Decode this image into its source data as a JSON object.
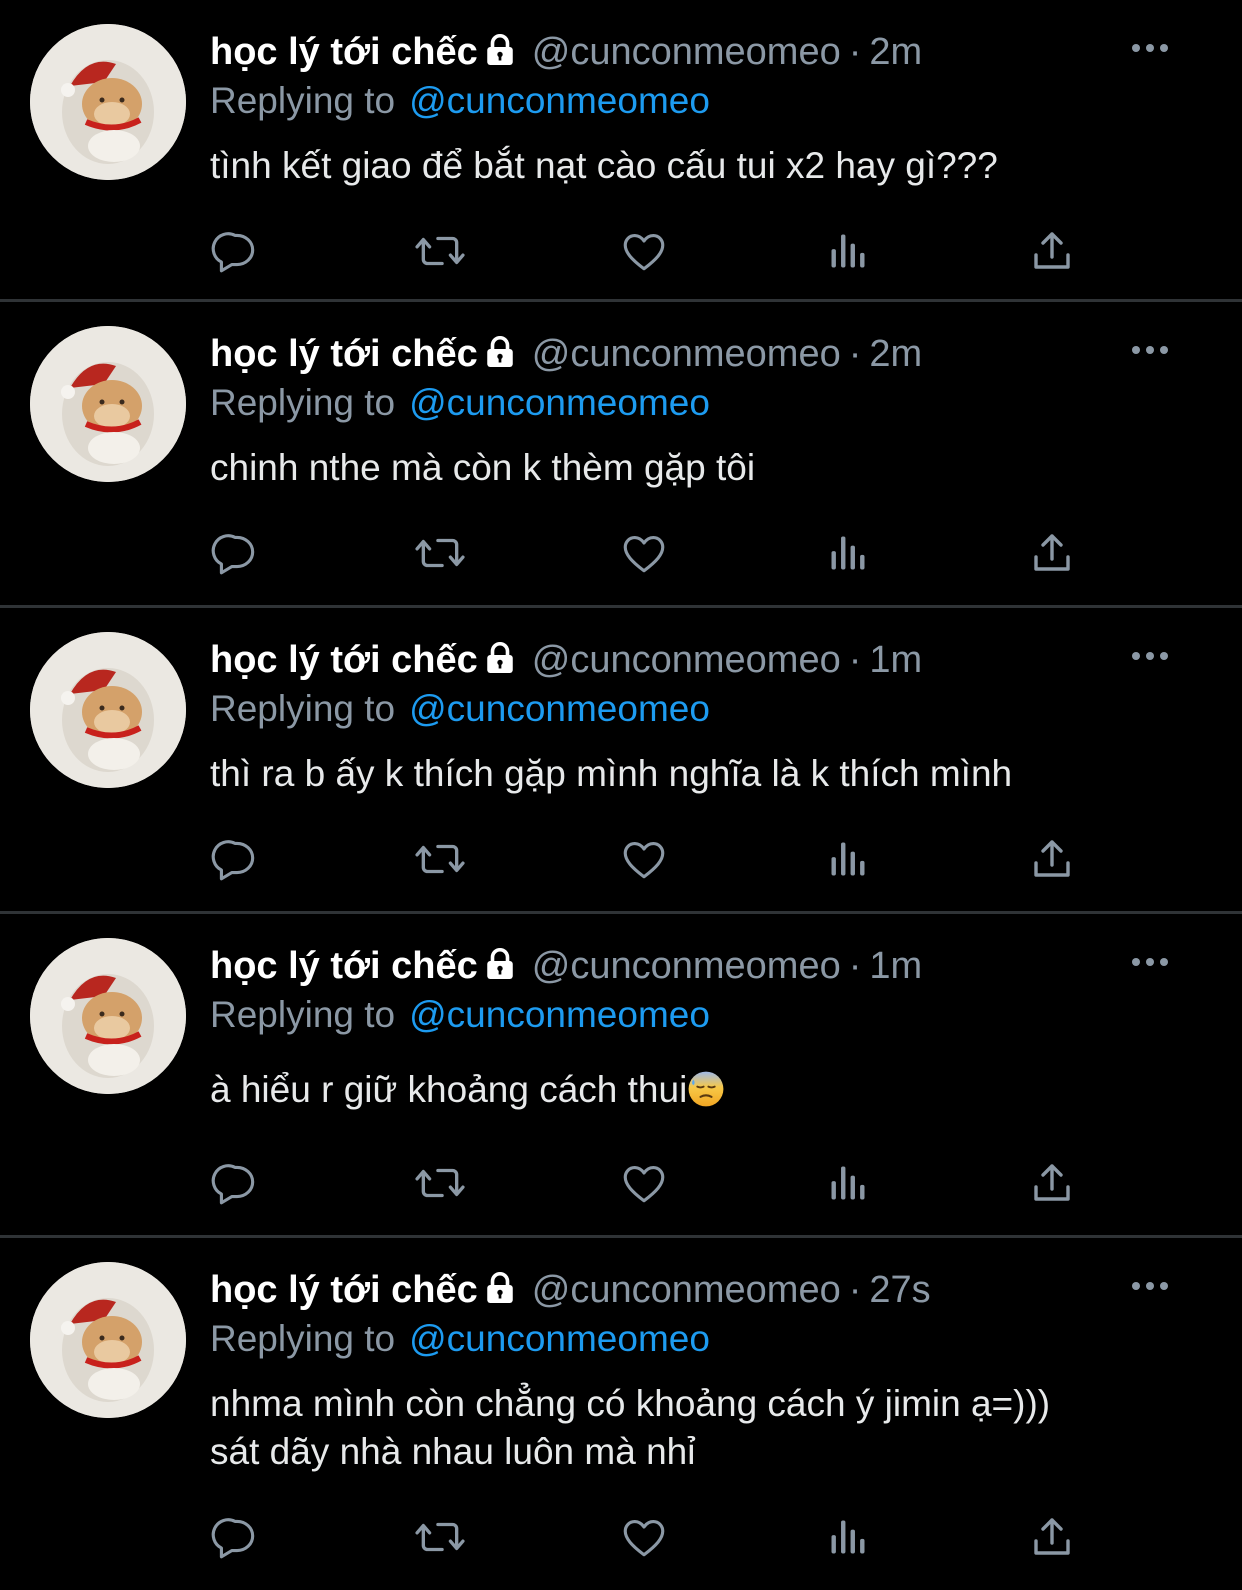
{
  "tweets": [
    {
      "name": "học lý tới chếc",
      "handle": "@cunconmeomeo",
      "time": "2m",
      "replying_label": "Replying to",
      "replying_to": "@cunconmeomeo",
      "lines": [
        "tình kết giao để bắt nạt cào cấu tui x2 hay gì???"
      ]
    },
    {
      "name": "học lý tới chếc",
      "handle": "@cunconmeomeo",
      "time": "2m",
      "replying_label": "Replying to",
      "replying_to": "@cunconmeomeo",
      "lines": [
        "chinh nthe mà còn k thèm gặp tôi"
      ]
    },
    {
      "name": "học lý tới chếc",
      "handle": "@cunconmeomeo",
      "time": "1m",
      "replying_label": "Replying to",
      "replying_to": "@cunconmeomeo",
      "lines": [
        "thì ra b ấy k thích gặp mình nghĩa là k thích mình"
      ]
    },
    {
      "name": "học lý tới chếc",
      "handle": "@cunconmeomeo",
      "time": "1m",
      "replying_label": "Replying to",
      "replying_to": "@cunconmeomeo",
      "lines": [
        "à hiểu r giữ khoảng cách thui"
      ],
      "emoji": "downcast-face-with-sweat-emoji"
    },
    {
      "name": "học lý tới chếc",
      "handle": "@cunconmeomeo",
      "time": "27s",
      "replying_label": "Replying to",
      "replying_to": "@cunconmeomeo",
      "lines": [
        "nhma mình còn chẳng có khoảng cách ý jimin ạ=)))",
        "sát dãy nhà nhau luôn mà nhỉ"
      ]
    }
  ],
  "separator": "·",
  "icons": [
    "reply-icon",
    "retweet-icon",
    "like-icon",
    "views-icon",
    "share-icon",
    "lock-icon",
    "more-icon"
  ],
  "colors": {
    "background": "#000000",
    "name": "#ffffff",
    "secondary": "#8b98a5",
    "link": "#1d9bf0",
    "divider": "#2f3336"
  }
}
